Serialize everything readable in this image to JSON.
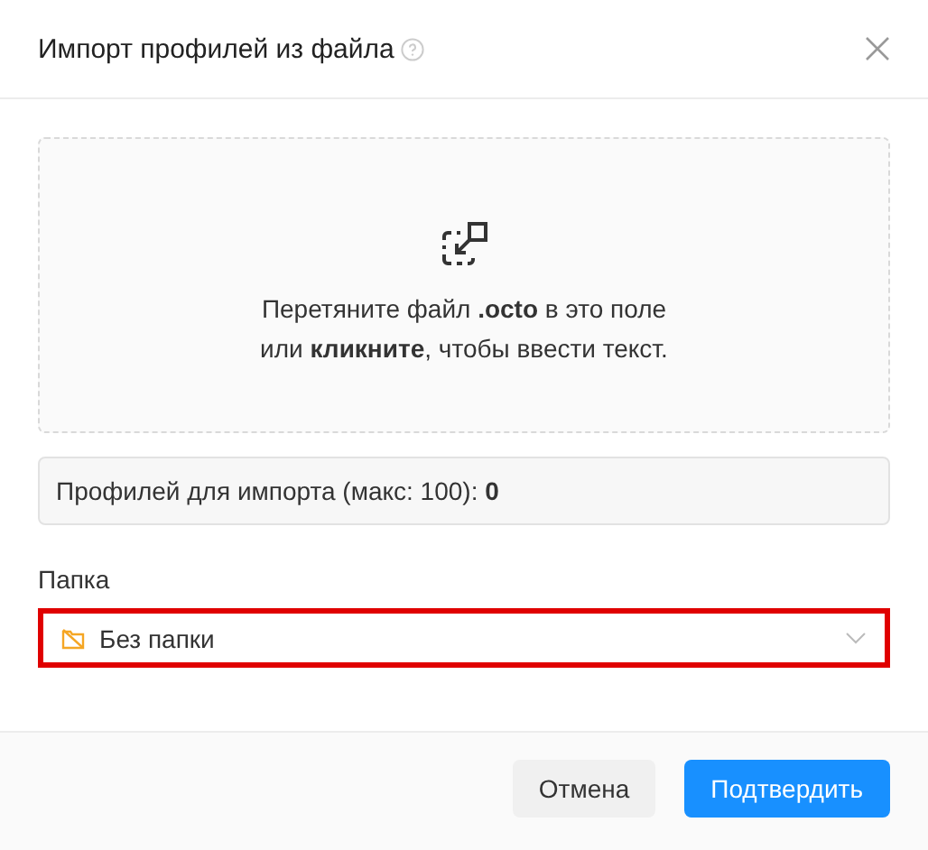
{
  "dialog": {
    "title": "Импорт профилей из файла"
  },
  "dropzone": {
    "lines": [
      "Перетяните файл **.octo** в это поле",
      "или **кликните**, чтобы ввести текст."
    ]
  },
  "count": "Профилей для импорта (макс: 100): **0**",
  "folder": {
    "label": "Папка",
    "value": "Без папки",
    "highlighted": true
  },
  "buttons": [
    {
      "label": "Отмена",
      "kind": "secondary"
    },
    {
      "label": "Подтвердить",
      "kind": "primary"
    }
  ]
}
